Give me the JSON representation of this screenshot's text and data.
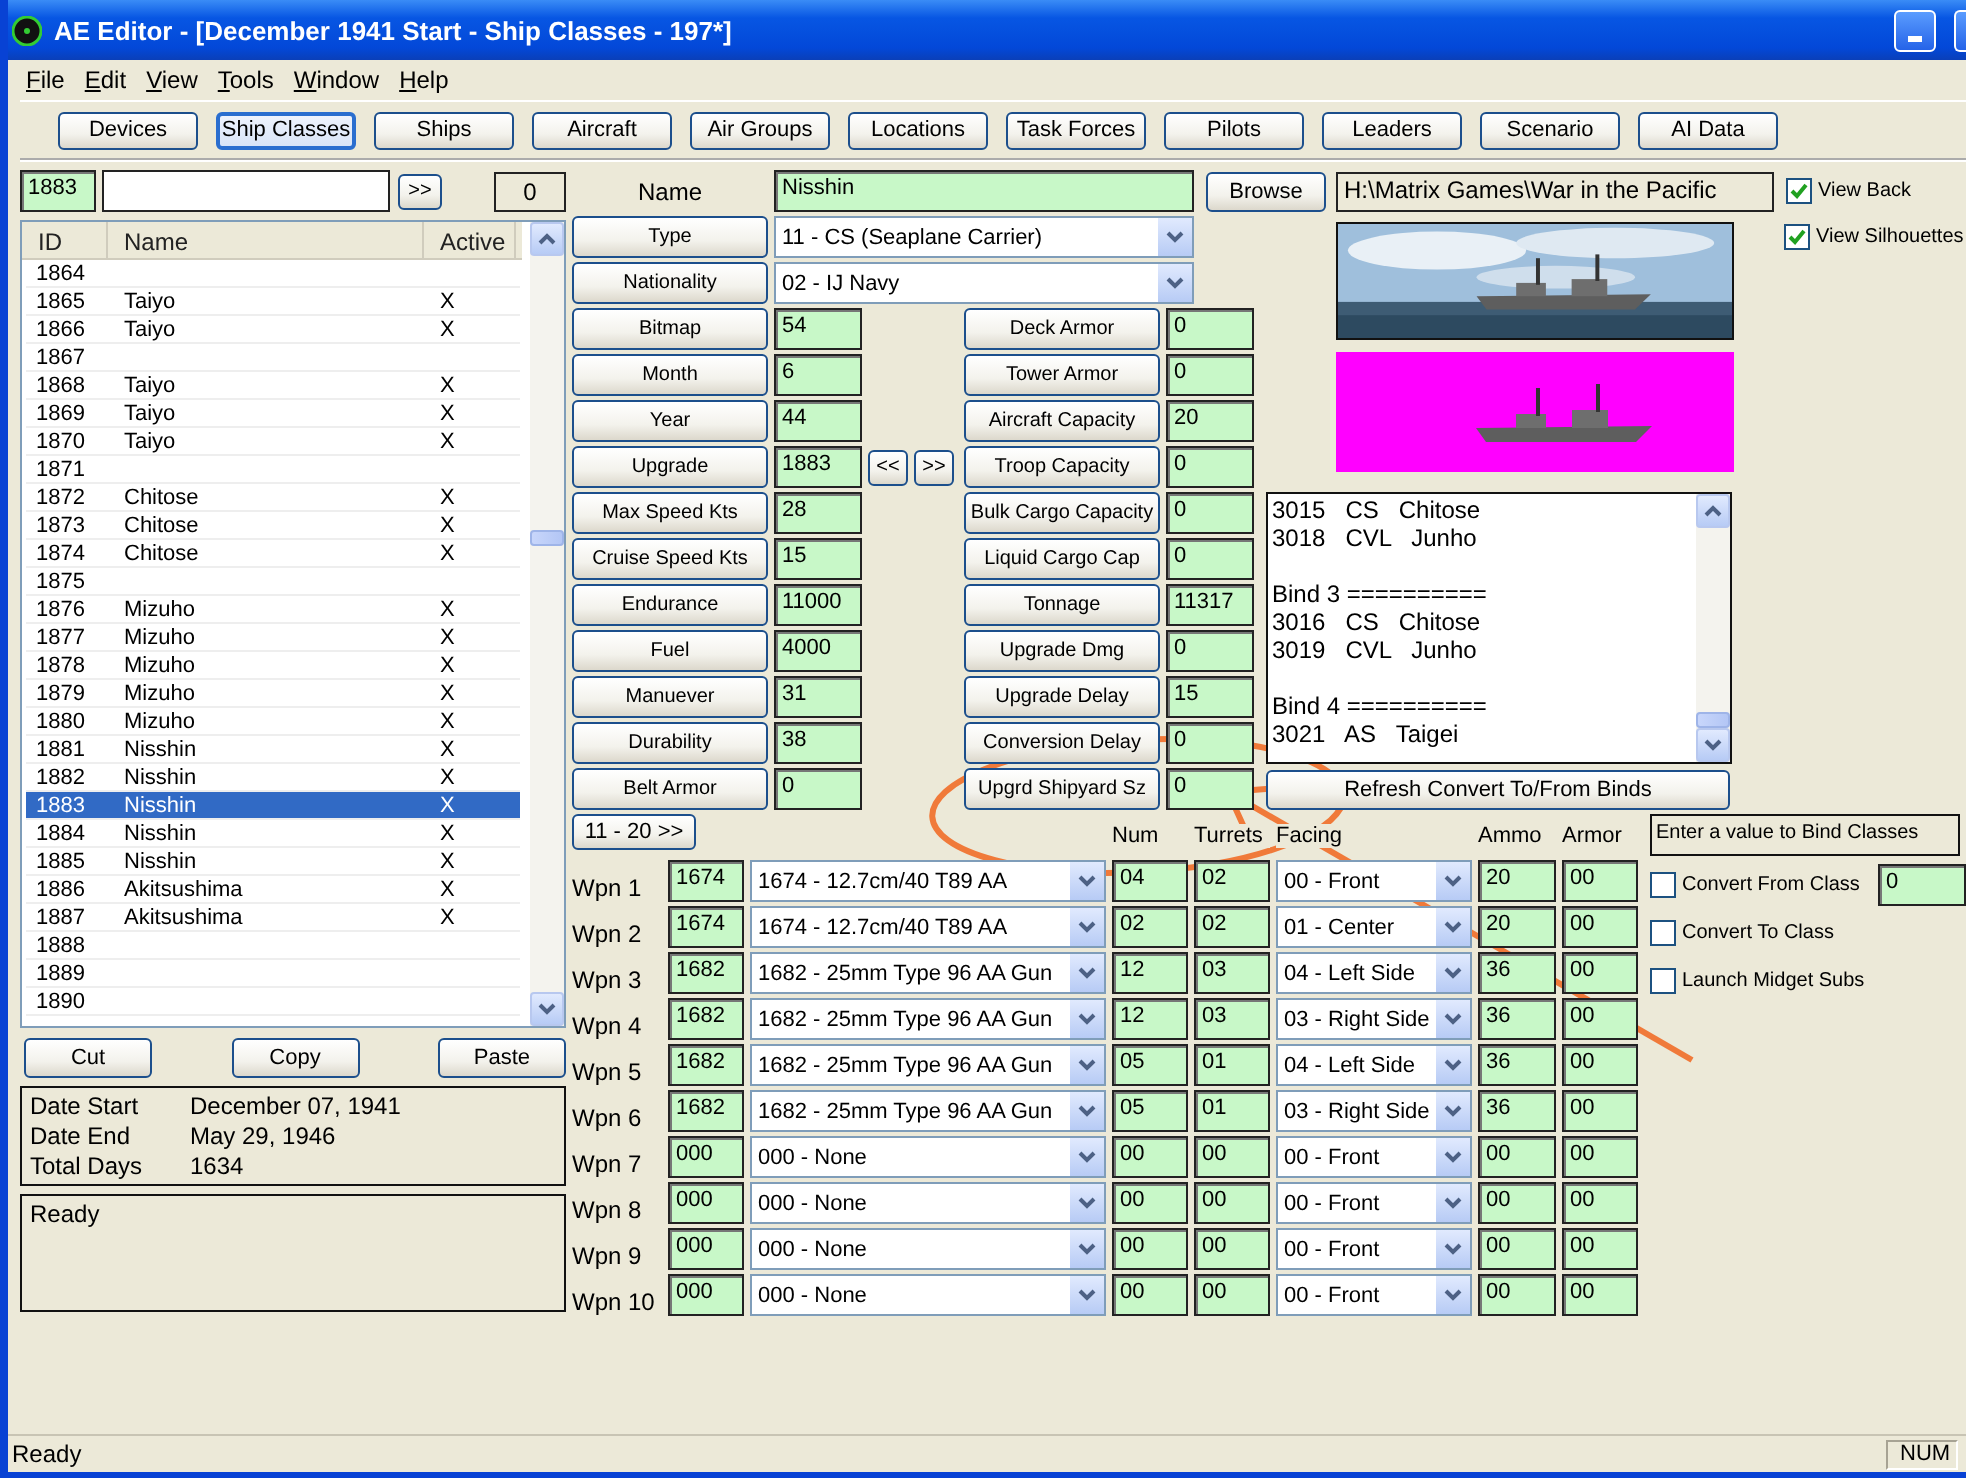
{
  "window": {
    "title": "AE Editor - [December 1941 Start - Ship Classes - 197*]"
  },
  "menu": [
    "File",
    "Edit",
    "View",
    "Tools",
    "Window",
    "Help"
  ],
  "toolbar": [
    {
      "label": "Devices",
      "selected": false
    },
    {
      "label": "Ship Classes",
      "selected": true
    },
    {
      "label": "Ships",
      "selected": false
    },
    {
      "label": "Aircraft",
      "selected": false
    },
    {
      "label": "Air Groups",
      "selected": false
    },
    {
      "label": "Locations",
      "selected": false
    },
    {
      "label": "Task Forces",
      "selected": false
    },
    {
      "label": "Pilots",
      "selected": false
    },
    {
      "label": "Leaders",
      "selected": false
    },
    {
      "label": "Scenario",
      "selected": false
    },
    {
      "label": "AI Data",
      "selected": false
    }
  ],
  "search": {
    "id": "1883",
    "button": ">>",
    "count": "0"
  },
  "ship_list": {
    "columns": [
      "ID",
      "Name",
      "Active"
    ],
    "rows": [
      {
        "id": "1864",
        "selected": false
      },
      {
        "id": "1865",
        "name": "Taiyo",
        "active": "X",
        "selected": false
      },
      {
        "id": "1866",
        "name": "Taiyo",
        "active": "X",
        "selected": false
      },
      {
        "id": "1867",
        "selected": false
      },
      {
        "id": "1868",
        "name": "Taiyo",
        "active": "X",
        "selected": false
      },
      {
        "id": "1869",
        "name": "Taiyo",
        "active": "X",
        "selected": false
      },
      {
        "id": "1870",
        "name": "Taiyo",
        "active": "X",
        "selected": false
      },
      {
        "id": "1871",
        "selected": false
      },
      {
        "id": "1872",
        "name": "Chitose",
        "active": "X",
        "selected": false
      },
      {
        "id": "1873",
        "name": "Chitose",
        "active": "X",
        "selected": false
      },
      {
        "id": "1874",
        "name": "Chitose",
        "active": "X",
        "selected": false
      },
      {
        "id": "1875",
        "selected": false
      },
      {
        "id": "1876",
        "name": "Mizuho",
        "active": "X",
        "selected": false
      },
      {
        "id": "1877",
        "name": "Mizuho",
        "active": "X",
        "selected": false
      },
      {
        "id": "1878",
        "name": "Mizuho",
        "active": "X",
        "selected": false
      },
      {
        "id": "1879",
        "name": "Mizuho",
        "active": "X",
        "selected": false
      },
      {
        "id": "1880",
        "name": "Mizuho",
        "active": "X",
        "selected": false
      },
      {
        "id": "1881",
        "name": "Nisshin",
        "active": "X",
        "selected": false
      },
      {
        "id": "1882",
        "name": "Nisshin",
        "active": "X",
        "selected": false
      },
      {
        "id": "1883",
        "name": "Nisshin",
        "active": "X",
        "selected": true
      },
      {
        "id": "1884",
        "name": "Nisshin",
        "active": "X",
        "selected": false
      },
      {
        "id": "1885",
        "name": "Nisshin",
        "active": "X",
        "selected": false
      },
      {
        "id": "1886",
        "name": "Akitsushima",
        "active": "X",
        "selected": false
      },
      {
        "id": "1887",
        "name": "Akitsushima",
        "active": "X",
        "selected": false
      },
      {
        "id": "1888",
        "selected": false
      },
      {
        "id": "1889",
        "selected": false
      },
      {
        "id": "1890",
        "selected": false
      }
    ]
  },
  "list_buttons": [
    "Cut",
    "Copy",
    "Paste"
  ],
  "dates": [
    {
      "label": "Date Start",
      "value": "December 07, 1941"
    },
    {
      "label": "Date End",
      "value": "May 29, 1946"
    },
    {
      "label": "Total Days",
      "value": "1634"
    }
  ],
  "log": {
    "text": "Ready"
  },
  "name": {
    "label": "Name",
    "value": "Nisshin"
  },
  "browse_button": "Browse",
  "path": "H:\\Matrix Games\\War in the Pacific",
  "view_options": [
    {
      "label": "View Back",
      "checked": true
    },
    {
      "label": "View Silhouettes",
      "checked": true
    }
  ],
  "selects": [
    {
      "label": "Type",
      "value": "11 - CS (Seaplane Carrier)"
    },
    {
      "label": "Nationality",
      "value": "02 - IJ Navy"
    }
  ],
  "fields_left": [
    {
      "label": "Bitmap",
      "value": "54"
    },
    {
      "label": "Month",
      "value": "6"
    },
    {
      "label": "Year",
      "value": "44"
    },
    {
      "label": "Upgrade",
      "value": "1883"
    },
    {
      "label": "Max Speed Kts",
      "value": "28"
    },
    {
      "label": "Cruise Speed Kts",
      "value": "15"
    },
    {
      "label": "Endurance",
      "value": "11000"
    },
    {
      "label": "Fuel",
      "value": "4000"
    },
    {
      "label": "Manuever",
      "value": "31"
    },
    {
      "label": "Durability",
      "value": "38"
    },
    {
      "label": "Belt Armor",
      "value": "0"
    }
  ],
  "upgrade_nav": [
    "<<",
    ">>"
  ],
  "fields_right": [
    {
      "label": "Deck Armor",
      "value": "0"
    },
    {
      "label": "Tower Armor",
      "value": "0"
    },
    {
      "label": "Aircraft Capacity",
      "value": "20"
    },
    {
      "label": "Troop Capacity",
      "value": "0"
    },
    {
      "label": "Bulk Cargo Capacity",
      "value": "0"
    },
    {
      "label": "Liquid Cargo Cap",
      "value": "0"
    },
    {
      "label": "Tonnage",
      "value": "11317"
    },
    {
      "label": "Upgrade Dmg",
      "value": "0"
    },
    {
      "label": "Upgrade Delay",
      "value": "15"
    },
    {
      "label": "Conversion Delay",
      "value": "0"
    },
    {
      "label": "Upgrd Shipyard Sz",
      "value": "0"
    }
  ],
  "images": [
    {
      "kind": "picture"
    },
    {
      "kind": "picture"
    }
  ],
  "bind_list": [
    {
      "lines": [
        "3015   CS   Chitose",
        "3018   CVL   Junho"
      ]
    },
    {
      "lines": [
        "Bind 3 ==========",
        "3016   CS   Chitose",
        "3019   CVL   Junho"
      ]
    },
    {
      "lines": [
        "Bind 4 ==========",
        "3021   AS   Taigei"
      ]
    }
  ],
  "refresh_button": "Refresh Convert To/From Binds",
  "weapons": {
    "page_button": "11 - 20 >>",
    "columns": [
      "Num",
      "Turrets",
      "Facing",
      "Ammo",
      "Armor"
    ],
    "rows": [
      {
        "label": "Wpn 1",
        "id": "1674",
        "device": "1674 - 12.7cm/40 T89 AA",
        "num": "04",
        "turrets": "02",
        "facing": "00 - Front",
        "ammo": "20",
        "armor": "00"
      },
      {
        "label": "Wpn 2",
        "id": "1674",
        "device": "1674 - 12.7cm/40 T89 AA",
        "num": "02",
        "turrets": "02",
        "facing": "01 - Center",
        "ammo": "20",
        "armor": "00"
      },
      {
        "label": "Wpn 3",
        "id": "1682",
        "device": "1682 - 25mm Type 96 AA Gun",
        "num": "12",
        "turrets": "03",
        "facing": "04 - Left Side",
        "ammo": "36",
        "armor": "00"
      },
      {
        "label": "Wpn 4",
        "id": "1682",
        "device": "1682 - 25mm Type 96 AA Gun",
        "num": "12",
        "turrets": "03",
        "facing": "03 - Right Side",
        "ammo": "36",
        "armor": "00"
      },
      {
        "label": "Wpn 5",
        "id": "1682",
        "device": "1682 - 25mm Type 96 AA Gun",
        "num": "05",
        "turrets": "01",
        "facing": "04 - Left Side",
        "ammo": "36",
        "armor": "00"
      },
      {
        "label": "Wpn 6",
        "id": "1682",
        "device": "1682 - 25mm Type 96 AA Gun",
        "num": "05",
        "turrets": "01",
        "facing": "03 - Right Side",
        "ammo": "36",
        "armor": "00"
      },
      {
        "label": "Wpn 7",
        "id": "000",
        "device": "000 - None",
        "num": "00",
        "turrets": "00",
        "facing": "00 - Front",
        "ammo": "00",
        "armor": "00"
      },
      {
        "label": "Wpn 8",
        "id": "000",
        "device": "000 - None",
        "num": "00",
        "turrets": "00",
        "facing": "00 - Front",
        "ammo": "00",
        "armor": "00"
      },
      {
        "label": "Wpn 9",
        "id": "000",
        "device": "000 - None",
        "num": "00",
        "turrets": "00",
        "facing": "00 - Front",
        "ammo": "00",
        "armor": "00"
      },
      {
        "label": "Wpn 10",
        "id": "000",
        "device": "000 - None",
        "num": "00",
        "turrets": "00",
        "facing": "00 - Front",
        "ammo": "00",
        "armor": "00"
      }
    ]
  },
  "bind": {
    "prompt": "Enter a value to Bind Classes",
    "options": [
      {
        "label": "Convert From Class",
        "checked": false,
        "value": "0"
      },
      {
        "label": "Convert To Class",
        "checked": false
      },
      {
        "label": "Launch Midget Subs",
        "checked": false
      }
    ]
  },
  "status_bar": {
    "text": "Ready",
    "indicator": "NUM"
  },
  "annotation": {
    "kind": "circled-arrow"
  }
}
